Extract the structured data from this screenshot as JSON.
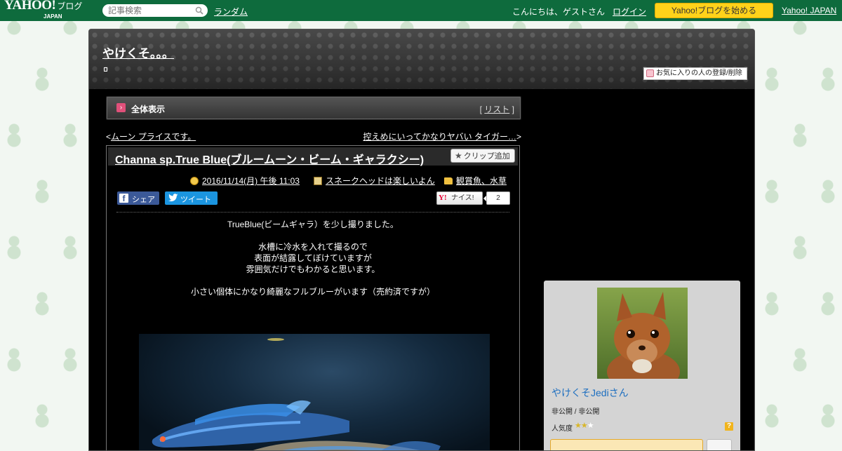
{
  "masthead": {
    "logo_text": "YAHOO!",
    "logo_suffix": "ブログ",
    "logo_sub": "JAPAN",
    "search_placeholder": "記事検索",
    "random_link": "ランダム",
    "greeting": "こんにちは、ゲストさん",
    "login_link": "ログイン",
    "start_blog_button": "Yahoo!ブログを始める",
    "yahoo_japan_link": "Yahoo! JAPAN"
  },
  "header": {
    "blog_title": "やけくそ。。。",
    "favorite_button": "お気に入りの人の登録/削除"
  },
  "full_bar": {
    "label": "全体表示",
    "list_open": "[",
    "list_link": "リスト",
    "list_close": "]"
  },
  "nav": {
    "prev_arrow": "<",
    "prev_link": "ムーン プライスです。",
    "next_link": "控えめにいってかなりヤバい タイガー…",
    "next_arrow": ">"
  },
  "article": {
    "title": "Channa sp.True Blue(ブルームーン・ビーム・ギャラクシー)",
    "clip_button": "クリップ追加",
    "date": "2016/11/14(月) 午後 11:03",
    "book_category": "スネークヘッドは楽しいよん",
    "folder_category": "観賞魚、水草",
    "share_button": "シェア",
    "tweet_button": "ツイート",
    "nice_button": "ナイス!",
    "nice_logo": "Y!",
    "nice_count": "2",
    "body": {
      "line1": "TrueBlue(ビームギャラ）を少し撮りました。",
      "line2": "水槽に冷水を入れて撮るので",
      "line3": "表面が結露してぼけていますが",
      "line4": "雰囲気だけでもわかると思います。",
      "line5": "小さい個体にかなり綺麗なフルブルーがいます（売約済ですが）"
    }
  },
  "profile": {
    "name": "やけくそJediさん",
    "visibility": "非公開 / 非公開",
    "popularity_label": "人気度",
    "popularity_stars": 2,
    "popularity_max": 3,
    "help_glyph": "?"
  },
  "colors": {
    "masthead": "#0e6b3d",
    "accent_yellow": "#ffd21a",
    "facebook": "#3b5998",
    "twitter": "#1b95e0",
    "profile_link": "#1e6fc0"
  },
  "icons": [
    "search-icon",
    "favorite-icon",
    "arrow-right-icon",
    "star-icon",
    "clock-icon",
    "book-icon",
    "folder-icon",
    "facebook-icon",
    "twitter-icon",
    "yahoo-y-icon",
    "help-icon"
  ]
}
